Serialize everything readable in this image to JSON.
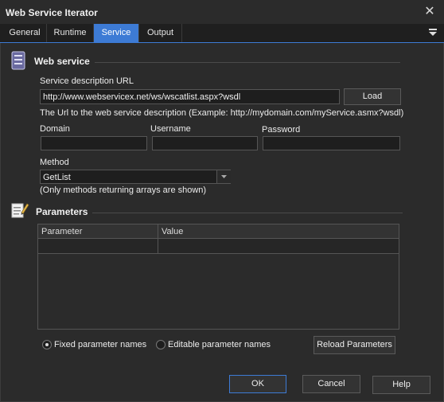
{
  "window": {
    "title": "Web Service Iterator"
  },
  "tabs": [
    {
      "label": "General"
    },
    {
      "label": "Runtime"
    },
    {
      "label": "Service"
    },
    {
      "label": "Output"
    }
  ],
  "active_tab": "Service",
  "web_service": {
    "heading": "Web service",
    "url_label": "Service description URL",
    "url_value": "http://www.webservicex.net/ws/wscatlist.aspx?wsdl",
    "load_button": "Load",
    "url_hint": "The Url to the web service description (Example: http://mydomain.com/myService.asmx?wsdl)",
    "domain_label": "Domain",
    "domain_value": "",
    "username_label": "Username",
    "username_value": "",
    "password_label": "Password",
    "password_value": "",
    "method_label": "Method",
    "method_value": "GetList",
    "method_hint": "(Only methods returning arrays are shown)"
  },
  "parameters": {
    "heading": "Parameters",
    "columns": [
      "Parameter",
      "Value"
    ],
    "rows": [
      [
        "",
        ""
      ]
    ],
    "fixed_names_label": "Fixed parameter names",
    "editable_names_label": "Editable parameter names",
    "fixed_names_selected": true,
    "reload_button": "Reload Parameters"
  },
  "footer": {
    "ok_button": "OK",
    "cancel_button": "Cancel",
    "help_button": "Help"
  },
  "colors": {
    "accent": "#3d7bd5",
    "background": "#2b2b2b"
  },
  "icons": [
    "close-icon",
    "tab-menu-icon",
    "web-service-icon",
    "parameters-icon",
    "dropdown-arrow-icon"
  ]
}
